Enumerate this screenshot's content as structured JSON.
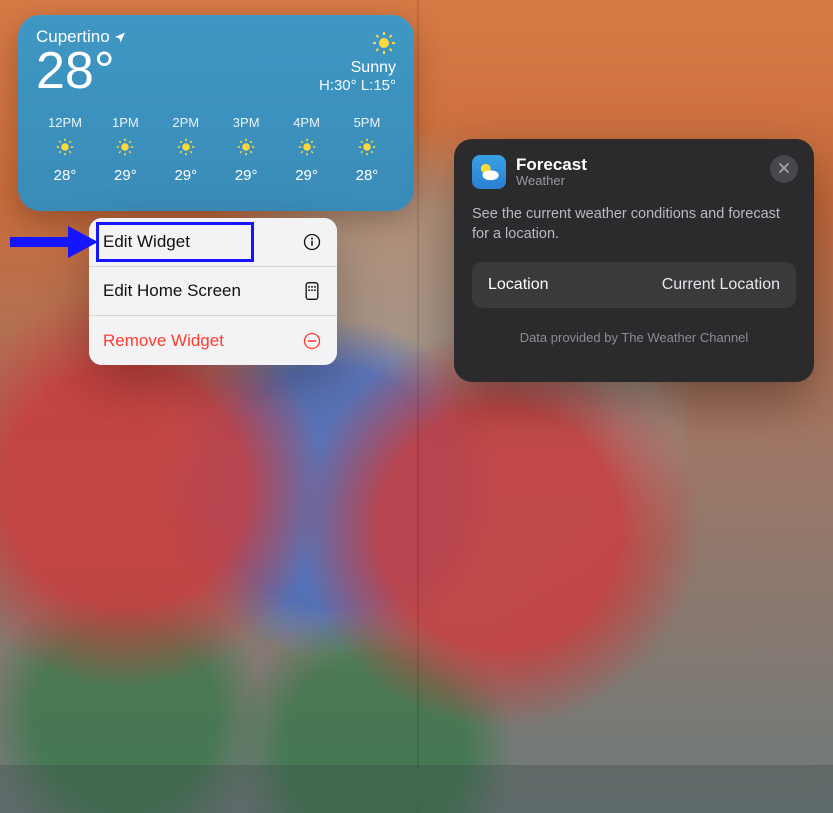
{
  "weather": {
    "location": "Cupertino",
    "temp": "28°",
    "condition": "Sunny",
    "hi_lo": "H:30° L:15°",
    "hours": [
      {
        "label": "12PM",
        "temp": "28°"
      },
      {
        "label": "1PM",
        "temp": "29°"
      },
      {
        "label": "2PM",
        "temp": "29°"
      },
      {
        "label": "3PM",
        "temp": "29°"
      },
      {
        "label": "4PM",
        "temp": "29°"
      },
      {
        "label": "5PM",
        "temp": "28°"
      }
    ]
  },
  "menu": {
    "edit_widget": "Edit Widget",
    "edit_home": "Edit Home Screen",
    "remove": "Remove Widget"
  },
  "panel": {
    "title": "Forecast",
    "subtitle": "Weather",
    "description": "See the current weather conditions and forecast for a location.",
    "row_label": "Location",
    "row_value": "Current Location",
    "credit": "Data provided by The Weather Channel"
  }
}
